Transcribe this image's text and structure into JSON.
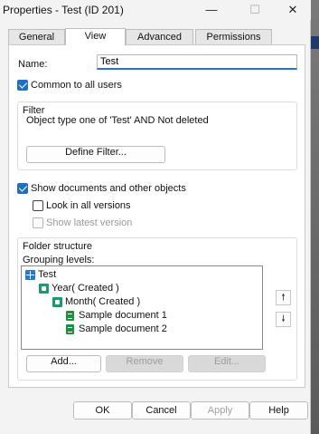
{
  "window": {
    "title": "Properties - Test (ID 201)",
    "minimize_icon": "minimize-icon",
    "maximize_icon": "maximize-icon",
    "close_icon": "close-icon",
    "minimize_glyph": "—",
    "maximize_glyph": "☐",
    "close_glyph": "✕"
  },
  "tabs": [
    {
      "label": "General",
      "active": false
    },
    {
      "label": "View",
      "active": true
    },
    {
      "label": "Advanced",
      "active": false
    },
    {
      "label": "Permissions",
      "active": false
    }
  ],
  "name": {
    "label": "Name:",
    "value": "Test"
  },
  "common_to_all_users": {
    "label": "Common to all users",
    "checked": true
  },
  "filter": {
    "title": "Filter",
    "description": "Object type one of 'Test' AND Not deleted",
    "define_button": "Define Filter..."
  },
  "show_documents": {
    "label": "Show documents and other objects",
    "checked": true
  },
  "look_in_all_versions": {
    "label": "Look in all versions",
    "checked": false
  },
  "show_latest_version": {
    "label": "Show latest version",
    "checked": false,
    "enabled": false
  },
  "folder_structure": {
    "title": "Folder structure",
    "grouping_label": "Grouping levels:",
    "tree": [
      {
        "label": "Test",
        "icon": "view-grid-icon"
      },
      {
        "label": "Year( Created )",
        "icon": "folder-icon"
      },
      {
        "label": "Month( Created )",
        "icon": "folder-icon"
      },
      {
        "label": "Sample document 1",
        "icon": "document-icon"
      },
      {
        "label": "Sample document 2",
        "icon": "document-icon"
      }
    ],
    "up_glyph": "🠕",
    "down_glyph": "🠗",
    "add_button": "Add...",
    "remove_button": "Remove",
    "edit_button": "Edit..."
  },
  "footer": {
    "ok": "OK",
    "cancel": "Cancel",
    "apply": "Apply",
    "help": "Help"
  },
  "colors": {
    "accent": "#1f6fc5",
    "folder": "#1e9a6a",
    "document": "#1e8f3c"
  }
}
